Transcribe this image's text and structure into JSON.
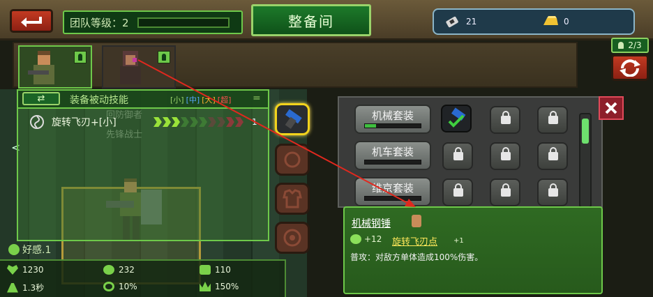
{
  "header": {
    "team_level_label": "团队等级：2",
    "title": "整备间",
    "resources": [
      {
        "icon": "ammo-clip-icon",
        "value": "21"
      },
      {
        "icon": "gold-bar-icon",
        "value": "0"
      }
    ]
  },
  "heroes": {
    "count": "2/3",
    "slots": [
      {
        "state": "active"
      },
      {
        "state": "inactive"
      }
    ]
  },
  "skill_panel": {
    "switch_label": "⇄",
    "title": "装备被动技能",
    "tiers": [
      "[小]",
      "[中]",
      "[大]",
      "[超]"
    ],
    "eq_symbol": "=",
    "rows": [
      {
        "name": "旋转飞刃+[小]",
        "progress_filled": 3,
        "progress_total": 10,
        "count": "1"
      }
    ],
    "ghost_text": [
      "回防御者",
      "先锋战士"
    ]
  },
  "nav": {
    "left_arrow": "<"
  },
  "favor": {
    "label": "好感.1"
  },
  "stats": [
    {
      "icon": "heart-icon",
      "value": "1230"
    },
    {
      "icon": "radiation-icon",
      "value": "232"
    },
    {
      "icon": "armor-icon",
      "value": "110"
    },
    {
      "icon": "speed-icon",
      "value": "1.3秒"
    },
    {
      "icon": "target-icon",
      "value": "10%"
    },
    {
      "icon": "crown-icon",
      "value": "150%"
    }
  ],
  "equipment_sets": [
    {
      "label": "机械套装",
      "progress": 0.2
    },
    {
      "label": "机车套装",
      "progress": 0
    },
    {
      "label": "维京套装",
      "progress": 0
    }
  ],
  "detail": {
    "item_name": "机械钢锤",
    "boost_value": "+12",
    "skill_name": "旋转飞刃点",
    "skill_plus": "+1",
    "description": "普攻：对敌方单体造成100%伤害。"
  },
  "colors": {
    "accent_green": "#6ec94a",
    "danger_red": "#c23a22",
    "highlight_yellow": "#f2d31c",
    "annotation_red": "#e0281e"
  }
}
